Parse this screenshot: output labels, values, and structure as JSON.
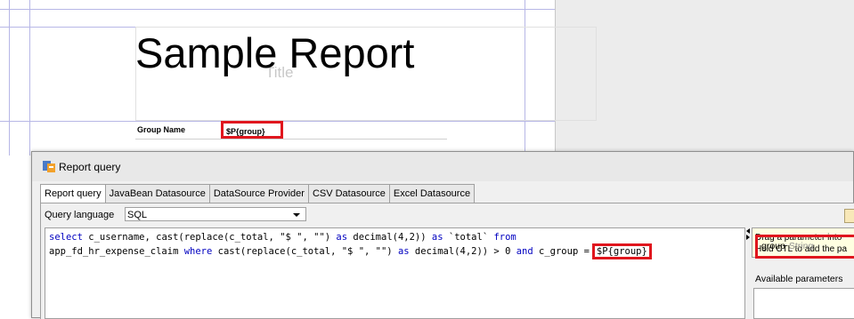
{
  "report": {
    "title": "Sample Report",
    "band_placeholder": "Title",
    "group_label": "Group Name",
    "group_field": "$P{group}"
  },
  "dialog": {
    "title": "Report query",
    "tabs": [
      {
        "label": "Report query",
        "active": true
      },
      {
        "label": "JavaBean Datasource",
        "active": false
      },
      {
        "label": "DataSource Provider",
        "active": false
      },
      {
        "label": "CSV Datasource",
        "active": false
      },
      {
        "label": "Excel Datasource",
        "active": false
      }
    ],
    "query_language_label": "Query language",
    "query_language_value": "SQL",
    "sql": {
      "line1_kw1": "select",
      "line1_mid": " c_username, cast(replace(c_total, \"$ \", \"\") ",
      "line1_kw2": "as",
      "line1_mid2": " decimal(4,2)) ",
      "line1_kw3": "as",
      "line1_mid3": " `total` ",
      "line1_kw4": "from",
      "line2_a": "app_fd_hr_expense_claim ",
      "line2_kw1": "where",
      "line2_b": " cast(replace(c_total, \"$ \", \"\") ",
      "line2_kw2": "as",
      "line2_c": " decimal(4,2)) > 0 ",
      "line2_kw3": "and",
      "line2_d": " c_group =",
      "param": "$P{group}"
    },
    "help_line1": "Drag a parameter into",
    "help_line2": "Hold CTL to add the pa",
    "available_label": "Available parameters",
    "parameter": {
      "name": "group",
      "type": "String"
    }
  },
  "colors": {
    "highlight": "#e0161e",
    "keyword": "#0000c0",
    "guide": "#b7b7e6"
  }
}
